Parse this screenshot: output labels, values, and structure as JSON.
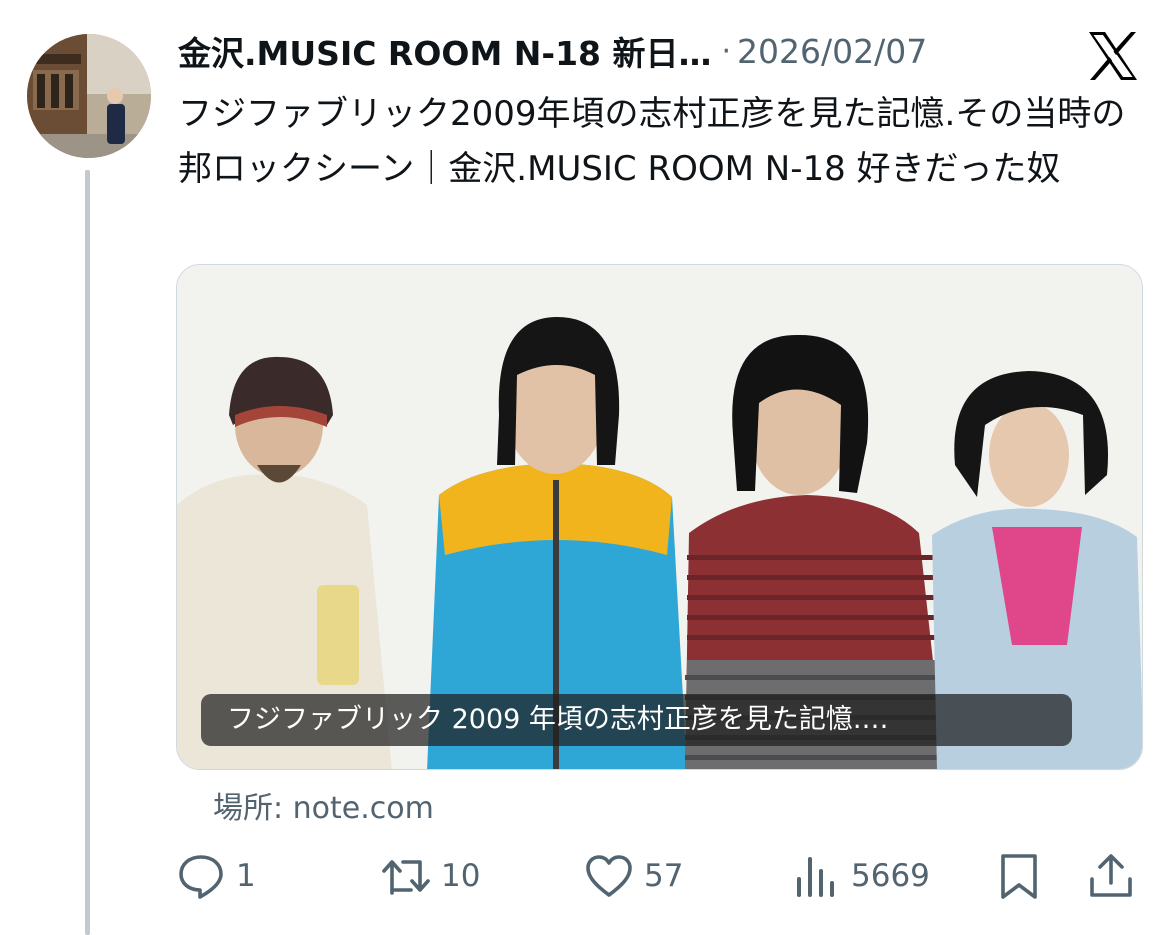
{
  "tweet": {
    "author": "金沢.MUSIC ROOM N-18 新日…",
    "separator": "·",
    "date": "2026/02/07",
    "text": "フジファブリック2009年頃の志村正彦を見た記憶.その当時の邦ロックシーン｜金沢.MUSIC ROOM N-18 好きだった奴"
  },
  "avatar": {
    "icon": "profile-photo-street"
  },
  "brand": {
    "icon": "x-logo",
    "color": "#000000"
  },
  "card": {
    "caption": "フジファブリック 2009 年頃の志村正彦を見た記憶.…",
    "image": "band-photo-four-members"
  },
  "source": {
    "text": "場所: note.com"
  },
  "actions": {
    "reply": {
      "icon": "reply-icon",
      "count": "1"
    },
    "retweet": {
      "icon": "retweet-icon",
      "count": "10"
    },
    "like": {
      "icon": "heart-icon",
      "count": "57"
    },
    "views": {
      "icon": "views-icon",
      "count": "5669"
    },
    "bookmark": {
      "icon": "bookmark-icon"
    },
    "share": {
      "icon": "share-icon"
    }
  },
  "colors": {
    "text": "#0f1419",
    "secondary": "#536471",
    "border": "#cfd9de"
  }
}
